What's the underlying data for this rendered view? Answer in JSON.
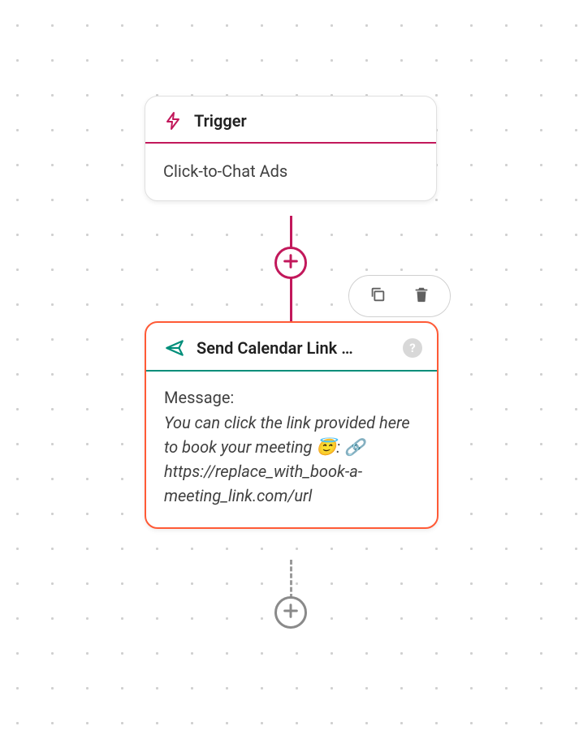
{
  "colors": {
    "accent_trigger": "#c2185b",
    "accent_action": "#008e7a",
    "selection": "#ff5a36",
    "muted": "#8a8a8a"
  },
  "trigger": {
    "icon": "lightning-bolt-icon",
    "title": "Trigger",
    "subtitle": "Click-to-Chat Ads"
  },
  "add_button": {
    "icon": "plus-icon"
  },
  "toolbar": {
    "copy_icon": "copy-icon",
    "delete_icon": "trash-icon"
  },
  "action": {
    "icon": "send-icon",
    "title": "Send Calendar Link …",
    "help_icon": "question-mark-icon",
    "message_label": "Message:",
    "message_text": "You can click the link provided here to book your meeting 😇: 🔗 https://replace_with_book-a-meeting_link.com/url"
  },
  "add_button_end": {
    "icon": "plus-icon"
  }
}
